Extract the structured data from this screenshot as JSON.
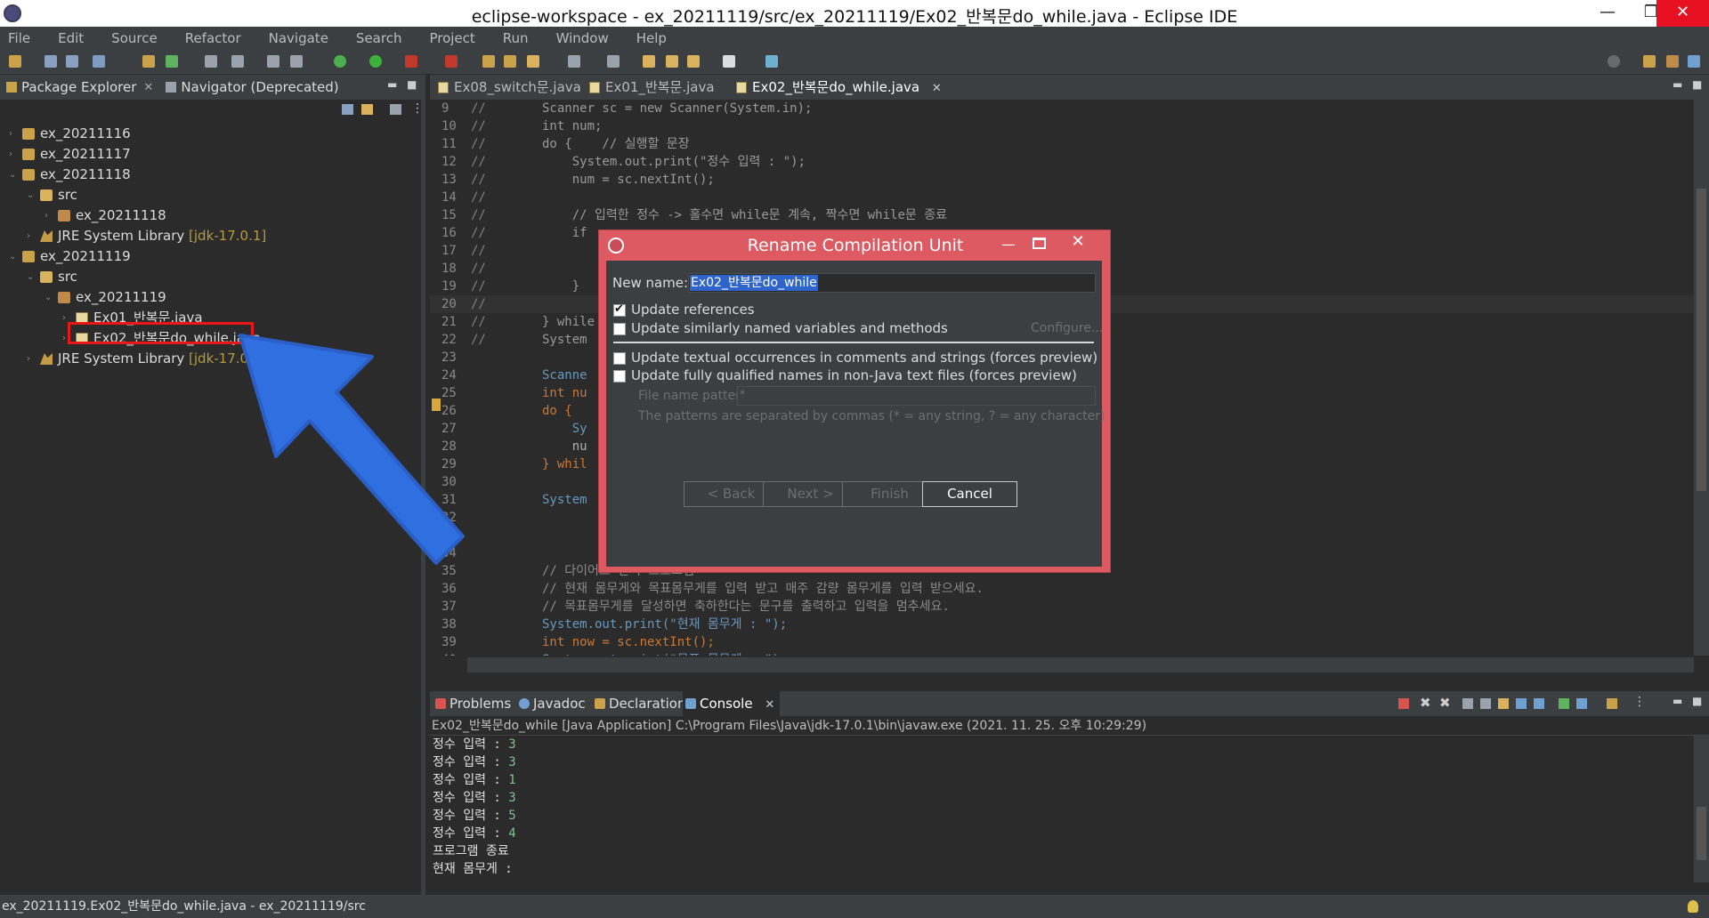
{
  "window": {
    "title": "eclipse-workspace - ex_20211119/src/ex_20211119/Ex02_반복문do_while.java - Eclipse IDE",
    "minimize": "—",
    "maximize": "❐",
    "close": "✕"
  },
  "menu": [
    "File",
    "Edit",
    "Source",
    "Refactor",
    "Navigate",
    "Search",
    "Project",
    "Run",
    "Window",
    "Help"
  ],
  "left_pane": {
    "tabs": [
      {
        "label": "Package Explorer",
        "close": "✕"
      },
      {
        "label": "Navigator (Deprecated)"
      }
    ],
    "tree": [
      {
        "label": "ex_20211116",
        "icon": "project-icon"
      },
      {
        "label": "ex_20211117",
        "icon": "project-icon"
      },
      {
        "label": "ex_20211118",
        "icon": "project-icon"
      },
      {
        "label": "src",
        "icon": "source-folder-icon"
      },
      {
        "label": "ex_20211118",
        "icon": "package-icon"
      },
      {
        "label": "JRE System Library",
        "version": "[jdk-17.0.1]",
        "icon": "library-icon"
      },
      {
        "label": "ex_20211119",
        "icon": "project-icon"
      },
      {
        "label": "src",
        "icon": "source-folder-icon"
      },
      {
        "label": "ex_20211119",
        "icon": "package-icon"
      },
      {
        "label": "Ex01_반복문.java",
        "icon": "java-file-icon"
      },
      {
        "label": "Ex02_반복문do_while.java",
        "icon": "java-file-icon",
        "selected": true
      },
      {
        "label": "JRE System Library",
        "version": "[jdk-17.0.1]",
        "icon": "library-icon"
      }
    ]
  },
  "editor": {
    "tabs": [
      {
        "label": "Ex08_switch문.java"
      },
      {
        "label": "Ex01_반복문.java"
      },
      {
        "label": "Ex02_반복문do_while.java",
        "active": true,
        "close": "✕"
      }
    ],
    "lines": [
      {
        "n": "9",
        "c": "//",
        "t": "Scanner sc = new Scanner(System.in);"
      },
      {
        "n": "10",
        "c": "//",
        "t": "int num;"
      },
      {
        "n": "11",
        "c": "//",
        "t": "do {    // 실행할 문장"
      },
      {
        "n": "12",
        "c": "//",
        "t": "    System.out.print(\"정수 입력 : \");"
      },
      {
        "n": "13",
        "c": "//",
        "t": "    num = sc.nextInt();"
      },
      {
        "n": "14",
        "c": "//",
        "t": ""
      },
      {
        "n": "15",
        "c": "//",
        "t": "    // 입력한 정수 -> 홀수면 while문 계속, 짝수면 while문 종료"
      },
      {
        "n": "16",
        "c": "//",
        "t": "    if"
      },
      {
        "n": "17",
        "c": "//",
        "t": ""
      },
      {
        "n": "18",
        "c": "//",
        "t": ""
      },
      {
        "n": "19",
        "c": "//",
        "t": "    }"
      },
      {
        "n": "20",
        "c": "//",
        "t": ""
      },
      {
        "n": "21",
        "c": "//",
        "t": "} while"
      },
      {
        "n": "22",
        "c": "//",
        "t": "System"
      },
      {
        "n": "23",
        "c": "",
        "t": ""
      },
      {
        "n": "24",
        "c": "",
        "t": "Scanne"
      },
      {
        "n": "25",
        "c": "",
        "t": "int nu"
      },
      {
        "n": "26",
        "c": "",
        "t": "do {"
      },
      {
        "n": "27",
        "c": "",
        "t": "    Sy"
      },
      {
        "n": "28",
        "c": "",
        "t": "    nu"
      },
      {
        "n": "29",
        "c": "",
        "t": "} whil"
      },
      {
        "n": "30",
        "c": "",
        "t": ""
      },
      {
        "n": "31",
        "c": "",
        "t": "System"
      },
      {
        "n": "32",
        "c": "",
        "t": ""
      },
      {
        "n": "33",
        "c": "",
        "t": ""
      },
      {
        "n": "34",
        "c": "",
        "t": ""
      },
      {
        "n": "35",
        "c": "",
        "t": "// 다이어트 관리 프로그램"
      },
      {
        "n": "36",
        "c": "",
        "t": "// 현재 몸무게와 목표몸무게를 입력 받고 매주 감량 몸무게를 입력 받으세요."
      },
      {
        "n": "37",
        "c": "",
        "t": "// 목표몸무게를 달성하면 축하한다는 문구를 출력하고 입력을 멈추세요."
      },
      {
        "n": "38",
        "c": "",
        "t": "System.out.print(\"현재 몸무게 : \");"
      },
      {
        "n": "39",
        "c": "",
        "t": "int now = sc.nextInt();"
      },
      {
        "n": "40",
        "c": "",
        "t": "System.out.print(\"목표 몸무게 : \");"
      }
    ]
  },
  "bottom_pane": {
    "tabs": [
      {
        "label": "Problems"
      },
      {
        "label": "Javadoc"
      },
      {
        "label": "Declaration"
      },
      {
        "label": "Console",
        "active": true,
        "close": "✕"
      }
    ],
    "console_header": "Ex02_반복문do_while [Java Application] C:\\Program Files\\Java\\jdk-17.0.1\\bin\\javaw.exe  (2021. 11. 25. 오후 10:29:29)",
    "lines": [
      {
        "prompt": "정수 입력 : ",
        "input": "3"
      },
      {
        "prompt": "정수 입력 : ",
        "input": "3"
      },
      {
        "prompt": "정수 입력 : ",
        "input": "1"
      },
      {
        "prompt": "정수 입력 : ",
        "input": "3"
      },
      {
        "prompt": "정수 입력 : ",
        "input": "5"
      },
      {
        "prompt": "정수 입력 : ",
        "input": "4"
      },
      {
        "prompt": "프로그램 종료",
        "input": ""
      },
      {
        "prompt": "현재 몸무게 : ",
        "input": ""
      }
    ]
  },
  "status_bar": {
    "text": "ex_20211119.Ex02_반복문do_while.java - ex_20211119/src"
  },
  "dialog": {
    "title": "Rename Compilation Unit",
    "new_name_label": "New name:",
    "new_name_value": "Ex02_반복문do_while",
    "options": [
      {
        "label": "Update references",
        "checked": true
      },
      {
        "label": "Update similarly named variables and methods",
        "checked": false
      },
      {
        "label": "Update textual occurrences in comments and strings (forces preview)",
        "checked": false
      },
      {
        "label": "Update fully qualified names in non-Java text files (forces preview)",
        "checked": false
      }
    ],
    "configure_link": "Configure...",
    "file_patterns_label": "File name patterns:",
    "file_patterns_value": "*",
    "patterns_hint": "The patterns are separated by commas (* = any string, ? = any character)",
    "buttons": {
      "back": "< Back",
      "next": "Next >",
      "finish": "Finish",
      "cancel": "Cancel"
    },
    "close": "✕",
    "minimize": "—"
  },
  "colors": {
    "dialog_frame": "#dd5a62",
    "selection_highlight": "#e81818",
    "annotation_arrow": "#2f6fe0"
  }
}
